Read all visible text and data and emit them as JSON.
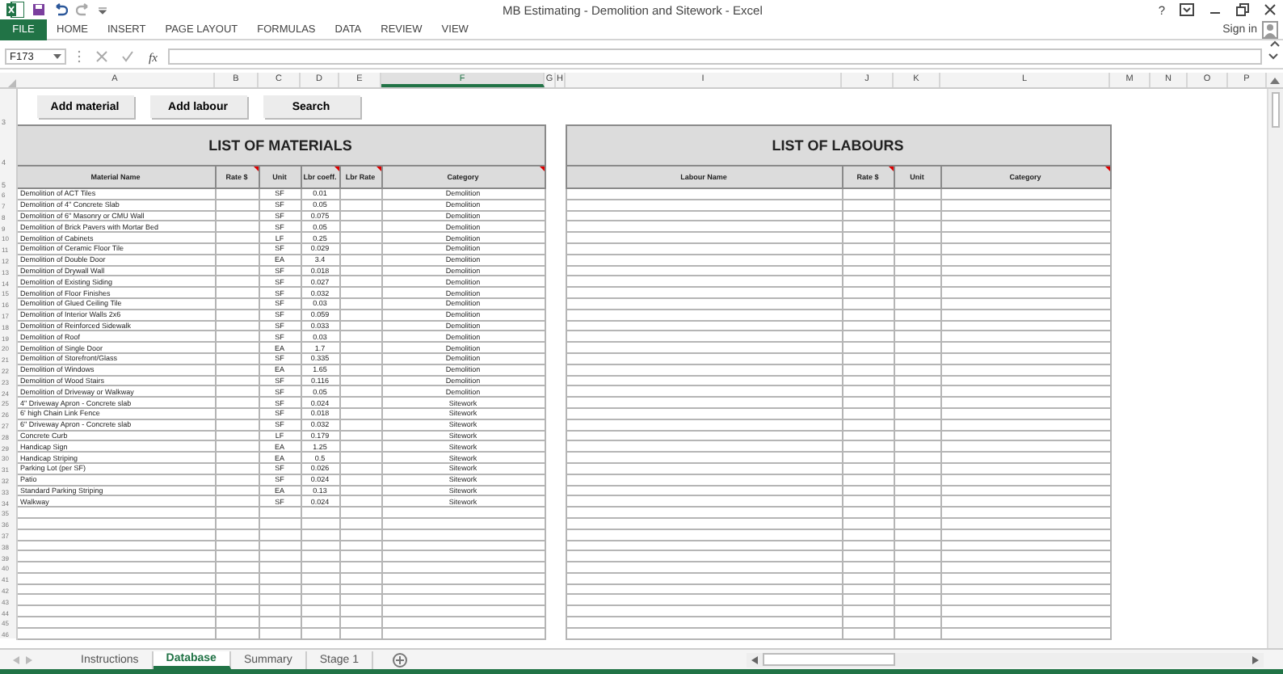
{
  "window": {
    "title": "MB Estimating - Demolition and Sitework - Excel",
    "help": "?"
  },
  "ribbon": {
    "file": "FILE",
    "tabs": [
      "HOME",
      "INSERT",
      "PAGE LAYOUT",
      "FORMULAS",
      "DATA",
      "REVIEW",
      "VIEW"
    ],
    "sign_in": "Sign in"
  },
  "formula_bar": {
    "name_box": "F173",
    "fx": "fx"
  },
  "columns": [
    {
      "label": "A",
      "selected": false
    },
    {
      "label": "B",
      "selected": false
    },
    {
      "label": "C",
      "selected": false
    },
    {
      "label": "D",
      "selected": false
    },
    {
      "label": "E",
      "selected": false
    },
    {
      "label": "F",
      "selected": true
    },
    {
      "label": "G",
      "selected": false
    },
    {
      "label": "H",
      "selected": false
    },
    {
      "label": "I",
      "selected": false
    },
    {
      "label": "J",
      "selected": false
    },
    {
      "label": "K",
      "selected": false
    },
    {
      "label": "L",
      "selected": false
    },
    {
      "label": "M",
      "selected": false
    },
    {
      "label": "N",
      "selected": false
    },
    {
      "label": "O",
      "selected": false
    },
    {
      "label": "P",
      "selected": false
    }
  ],
  "buttons_row": "3",
  "buttons": [
    "Add material",
    "Add labour",
    "Search"
  ],
  "title_row": "4",
  "header_row": "5",
  "materials": {
    "title": "LIST OF MATERIALS",
    "headers": [
      {
        "label": "Material Name",
        "comment": false
      },
      {
        "label": "Rate $",
        "comment": true
      },
      {
        "label": "Unit",
        "comment": false
      },
      {
        "label": "Lbr coeff.",
        "comment": true
      },
      {
        "label": "Lbr Rate",
        "comment": true
      },
      {
        "label": "Category",
        "comment": true
      }
    ],
    "rows": [
      {
        "row": "6",
        "name": "Demolition of ACT Tiles",
        "unit": "SF",
        "coeff": "0.01",
        "category": "Demolition"
      },
      {
        "row": "7",
        "name": "Demolition of 4\" Concrete Slab",
        "unit": "SF",
        "coeff": "0.05",
        "category": "Demolition"
      },
      {
        "row": "8",
        "name": "Demolition of 6\" Masonry or CMU Wall",
        "unit": "SF",
        "coeff": "0.075",
        "category": "Demolition"
      },
      {
        "row": "9",
        "name": "Demolition of Brick Pavers with Mortar Bed",
        "unit": "SF",
        "coeff": "0.05",
        "category": "Demolition"
      },
      {
        "row": "10",
        "name": "Demolition of Cabinets",
        "unit": "LF",
        "coeff": "0.25",
        "category": "Demolition"
      },
      {
        "row": "11",
        "name": "Demolition of Ceramic Floor Tile",
        "unit": "SF",
        "coeff": "0.029",
        "category": "Demolition"
      },
      {
        "row": "12",
        "name": "Demolition of Double Door",
        "unit": "EA",
        "coeff": "3.4",
        "category": "Demolition"
      },
      {
        "row": "13",
        "name": "Demolition of Drywall Wall",
        "unit": "SF",
        "coeff": "0.018",
        "category": "Demolition"
      },
      {
        "row": "14",
        "name": "Demolition of Existing Siding",
        "unit": "SF",
        "coeff": "0.027",
        "category": "Demolition"
      },
      {
        "row": "15",
        "name": "Demolition of Floor Finishes",
        "unit": "SF",
        "coeff": "0.032",
        "category": "Demolition"
      },
      {
        "row": "16",
        "name": "Demolition of Glued Ceiling Tile",
        "unit": "SF",
        "coeff": "0.03",
        "category": "Demolition"
      },
      {
        "row": "17",
        "name": "Demolition of Interior Walls 2x6",
        "unit": "SF",
        "coeff": "0.059",
        "category": "Demolition"
      },
      {
        "row": "18",
        "name": "Demolition of Reinforced Sidewalk",
        "unit": "SF",
        "coeff": "0.033",
        "category": "Demolition"
      },
      {
        "row": "19",
        "name": "Demolition of Roof",
        "unit": "SF",
        "coeff": "0.03",
        "category": "Demolition"
      },
      {
        "row": "20",
        "name": "Demolition of Single Door",
        "unit": "EA",
        "coeff": "1.7",
        "category": "Demolition"
      },
      {
        "row": "21",
        "name": "Demolition of Storefront/Glass",
        "unit": "SF",
        "coeff": "0.335",
        "category": "Demolition"
      },
      {
        "row": "22",
        "name": "Demolition of Windows",
        "unit": "EA",
        "coeff": "1.65",
        "category": "Demolition"
      },
      {
        "row": "23",
        "name": "Demolition of Wood Stairs",
        "unit": "SF",
        "coeff": "0.116",
        "category": "Demolition"
      },
      {
        "row": "24",
        "name": "Demolition of Driveway or Walkway",
        "unit": "SF",
        "coeff": "0.05",
        "category": "Demolition"
      },
      {
        "row": "25",
        "name": "4\" Driveway Apron - Concrete slab",
        "unit": "SF",
        "coeff": "0.024",
        "category": "Sitework"
      },
      {
        "row": "26",
        "name": "6' high Chain Link Fence",
        "unit": "SF",
        "coeff": "0.018",
        "category": "Sitework"
      },
      {
        "row": "27",
        "name": "6\" Driveway Apron - Concrete slab",
        "unit": "SF",
        "coeff": "0.032",
        "category": "Sitework"
      },
      {
        "row": "28",
        "name": "Concrete Curb",
        "unit": "LF",
        "coeff": "0.179",
        "category": "Sitework"
      },
      {
        "row": "29",
        "name": "Handicap Sign",
        "unit": "EA",
        "coeff": "1.25",
        "category": "Sitework"
      },
      {
        "row": "30",
        "name": "Handicap Striping",
        "unit": "EA",
        "coeff": "0.5",
        "category": "Sitework"
      },
      {
        "row": "31",
        "name": "Parking Lot (per SF)",
        "unit": "SF",
        "coeff": "0.026",
        "category": "Sitework"
      },
      {
        "row": "32",
        "name": "Patio",
        "unit": "SF",
        "coeff": "0.024",
        "category": "Sitework"
      },
      {
        "row": "33",
        "name": "Standard Parking Striping",
        "unit": "EA",
        "coeff": "0.13",
        "category": "Sitework"
      },
      {
        "row": "34",
        "name": "Walkway",
        "unit": "SF",
        "coeff": "0.024",
        "category": "Sitework"
      }
    ]
  },
  "empty_rows": [
    "35",
    "36",
    "37",
    "38",
    "39",
    "40",
    "41",
    "42",
    "43",
    "44",
    "45",
    "46"
  ],
  "labours": {
    "title": "LIST OF LABOURS",
    "headers": [
      {
        "label": "Labour Name",
        "comment": false
      },
      {
        "label": "Rate $",
        "comment": true
      },
      {
        "label": "Unit",
        "comment": false
      },
      {
        "label": "Category",
        "comment": true
      }
    ]
  },
  "sheet_tabs": [
    {
      "label": "Instructions",
      "selected": false
    },
    {
      "label": "Database",
      "selected": true
    },
    {
      "label": "Summary",
      "selected": false
    },
    {
      "label": "Stage 1",
      "selected": false
    }
  ]
}
